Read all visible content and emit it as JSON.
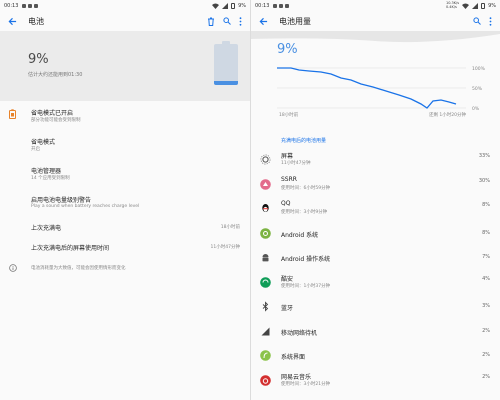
{
  "left": {
    "status": {
      "time": "00:13",
      "battery": "9%"
    },
    "appbar": {
      "title": "电池"
    },
    "hero": {
      "percent": "9%",
      "estimate": "估计大约还能用到01:30",
      "level": 0.09
    },
    "rows": [
      {
        "title": "省电模式已开启",
        "sub": "部分功能可能会受到限制"
      },
      {
        "title": "省电模式",
        "sub": "开启"
      },
      {
        "title": "电池管理器",
        "sub": "14 个应用受到限制"
      },
      {
        "title": "启用电池电量级别警告",
        "sub": "Play a sound when battery reaches charge level"
      },
      {
        "title": "上次充满电",
        "value": "18小时前"
      },
      {
        "title": "上次充满电后的屏幕使用时间",
        "value": "11小时47分钟"
      }
    ],
    "note": "电池消耗量为大致值，可能会因使用情形而变化"
  },
  "right": {
    "status": {
      "time": "00:13",
      "speed_top": "10.3K/s",
      "speed_bottom": "0.4K/s",
      "battery": "9%"
    },
    "appbar": {
      "title": "电池用量"
    },
    "percent": "9%",
    "chart": {
      "ylabels": [
        "100%",
        "50%",
        "0%"
      ],
      "xlabel_left": "18小时前",
      "xlabel_right": "还剩 1小时20分钟"
    },
    "section": "充满电后的电池用量",
    "apps": [
      {
        "name": "屏幕",
        "usage": "11小时47分钟",
        "pct": "33%",
        "icon": "brightness-icon",
        "color": "#555555"
      },
      {
        "name": "SSRR",
        "usage": "使用时间：6小时59分钟",
        "pct": "30%",
        "icon": "ssrr-icon",
        "color": "#e36b8c"
      },
      {
        "name": "QQ",
        "usage": "使用时间：3小时9分钟",
        "pct": "8%",
        "icon": "qq-penguin-icon",
        "color": "#111111"
      },
      {
        "name": "Android 系统",
        "usage": "",
        "pct": "8%",
        "icon": "android-system-icon",
        "color": "#7cb342"
      },
      {
        "name": "Android 操作系统",
        "usage": "",
        "pct": "7%",
        "icon": "android-os-icon",
        "color": "#555555"
      },
      {
        "name": "酷安",
        "usage": "使用时间：1小时37分钟",
        "pct": "4%",
        "icon": "coolapk-icon",
        "color": "#0f9d58"
      },
      {
        "name": "蓝牙",
        "usage": "",
        "pct": "3%",
        "icon": "bluetooth-icon",
        "color": "#444444"
      },
      {
        "name": "移动网络待机",
        "usage": "",
        "pct": "2%",
        "icon": "signal-icon",
        "color": "#444444"
      },
      {
        "name": "系统界面",
        "usage": "",
        "pct": "2%",
        "icon": "system-ui-icon",
        "color": "#8bc34a"
      },
      {
        "name": "网易云音乐",
        "usage": "使用时间：3小时21分钟",
        "pct": "2%",
        "icon": "netease-music-icon",
        "color": "#d32f2f"
      }
    ]
  }
}
